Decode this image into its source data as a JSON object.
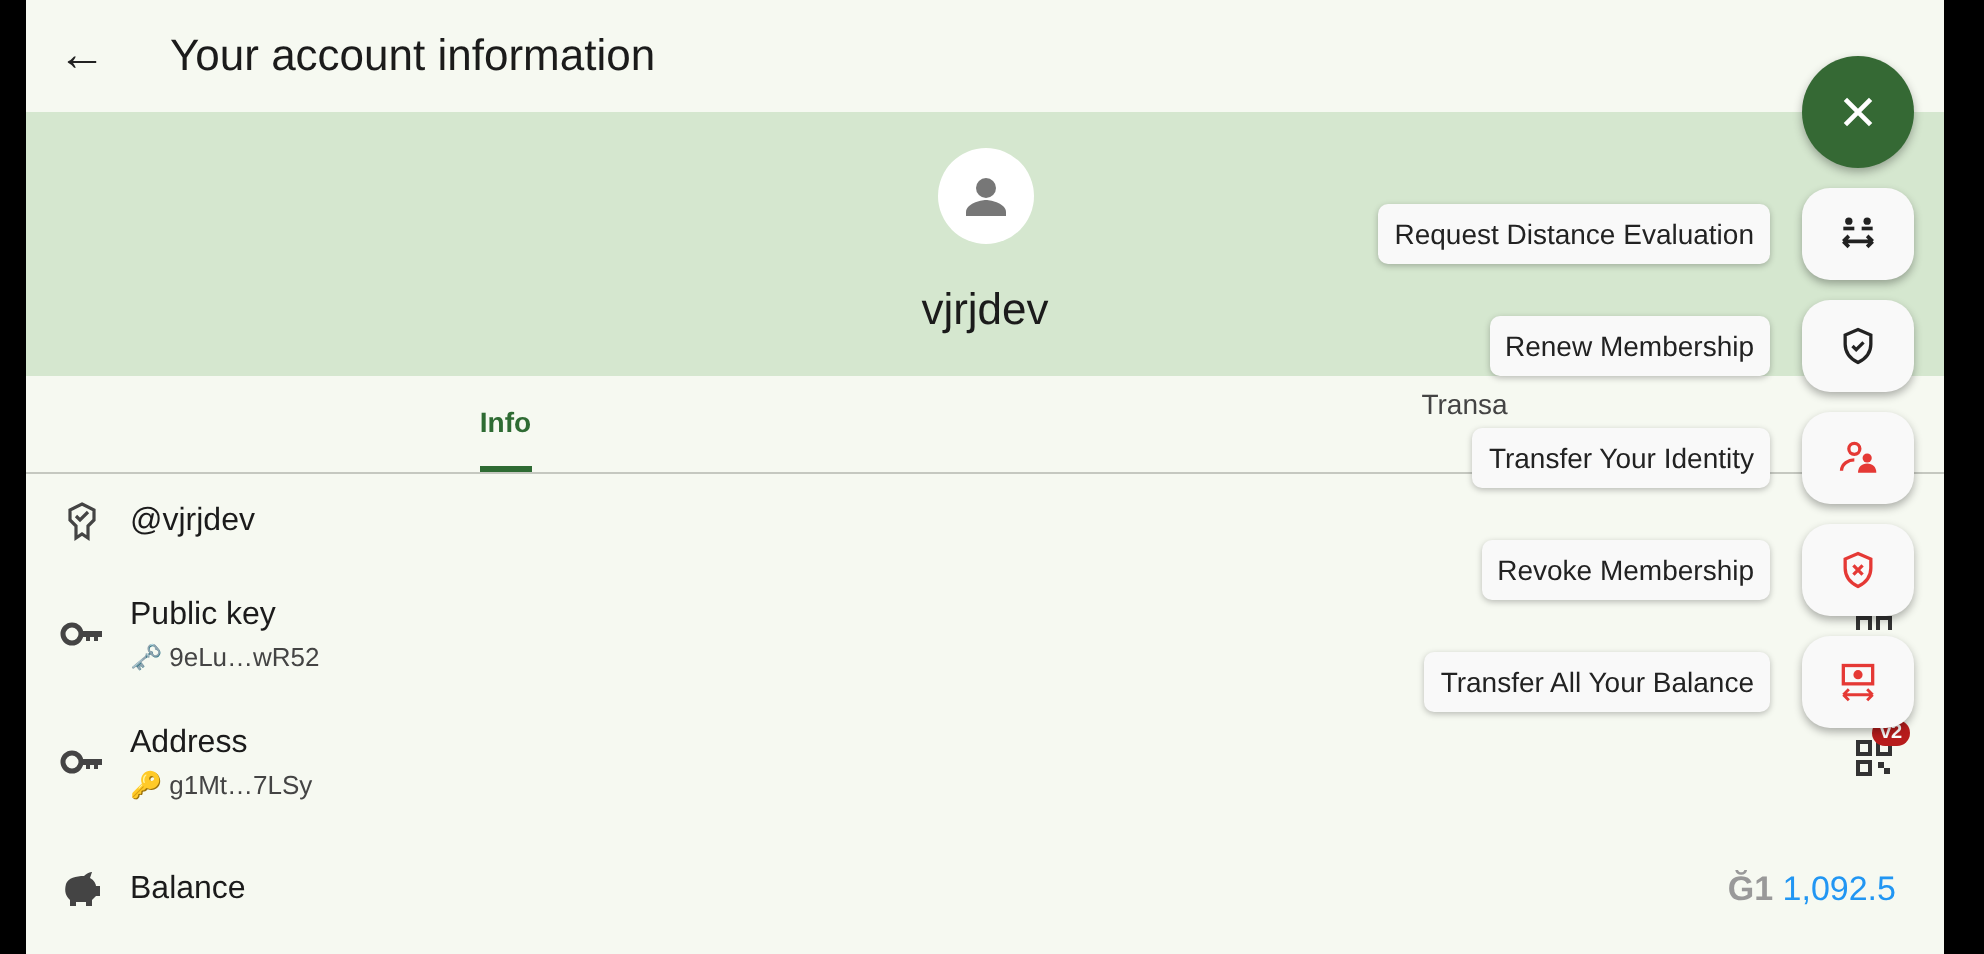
{
  "app_bar": {
    "back": "←",
    "title": "Your account information"
  },
  "profile": {
    "name": "vjrjdev"
  },
  "tabs": [
    {
      "label": "Info",
      "selected": true
    },
    {
      "label": "Transa",
      "selected": false
    }
  ],
  "rows": [
    {
      "kind": "username",
      "title": "@vjrjdev"
    },
    {
      "kind": "pubkey",
      "title": "Public key",
      "value": "🗝️ 9eLu…wR52"
    },
    {
      "kind": "address",
      "title": "Address",
      "value": "🔑 g1Mt…7LSy",
      "badge": "v2"
    },
    {
      "kind": "balance",
      "title": "Balance",
      "currency": "Ğ1",
      "amount": "1,092.5"
    }
  ],
  "fab_menu": {
    "expanded": true,
    "actions": [
      {
        "kind": "distance",
        "label": "Request Distance Evaluation"
      },
      {
        "kind": "renew",
        "label": "Renew Membership"
      },
      {
        "kind": "identity",
        "label": "Transfer Your Identity"
      },
      {
        "kind": "revoke",
        "label": "Revoke Membership"
      },
      {
        "kind": "balance",
        "label": "Transfer All Your Balance"
      }
    ]
  }
}
